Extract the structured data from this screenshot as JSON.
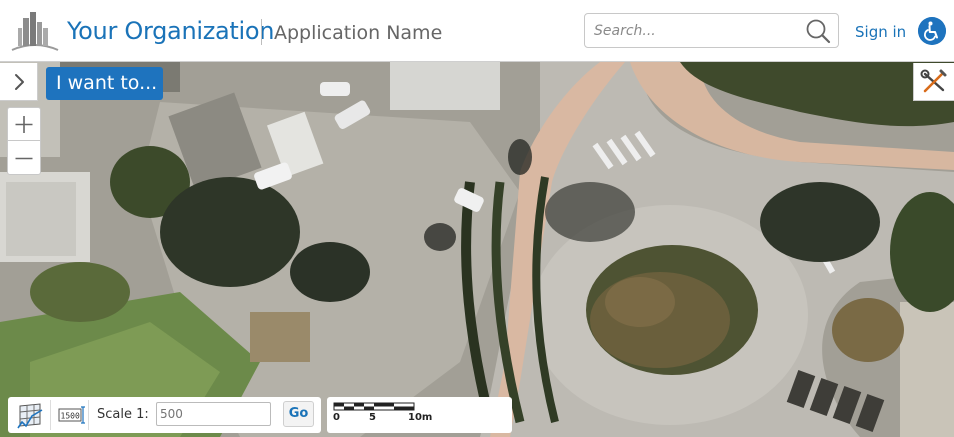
{
  "header": {
    "org_name": "Your Organization",
    "app_name": "Application Name",
    "search_placeholder": "Search...",
    "sign_in": "Sign in",
    "accent": "#1e73be"
  },
  "map": {
    "toggle_icon": "chevron-right-icon",
    "want_button": "I want to...",
    "tools_icon": "wrench-screwdriver-icon",
    "zoom_in": "+",
    "zoom_out": "−"
  },
  "footer": {
    "scale_label": "Scale 1:",
    "scale_placeholder": "500",
    "go": "Go",
    "scale_icon_text": "1500",
    "scalebar_labels": [
      "0",
      "5",
      "10m"
    ]
  }
}
